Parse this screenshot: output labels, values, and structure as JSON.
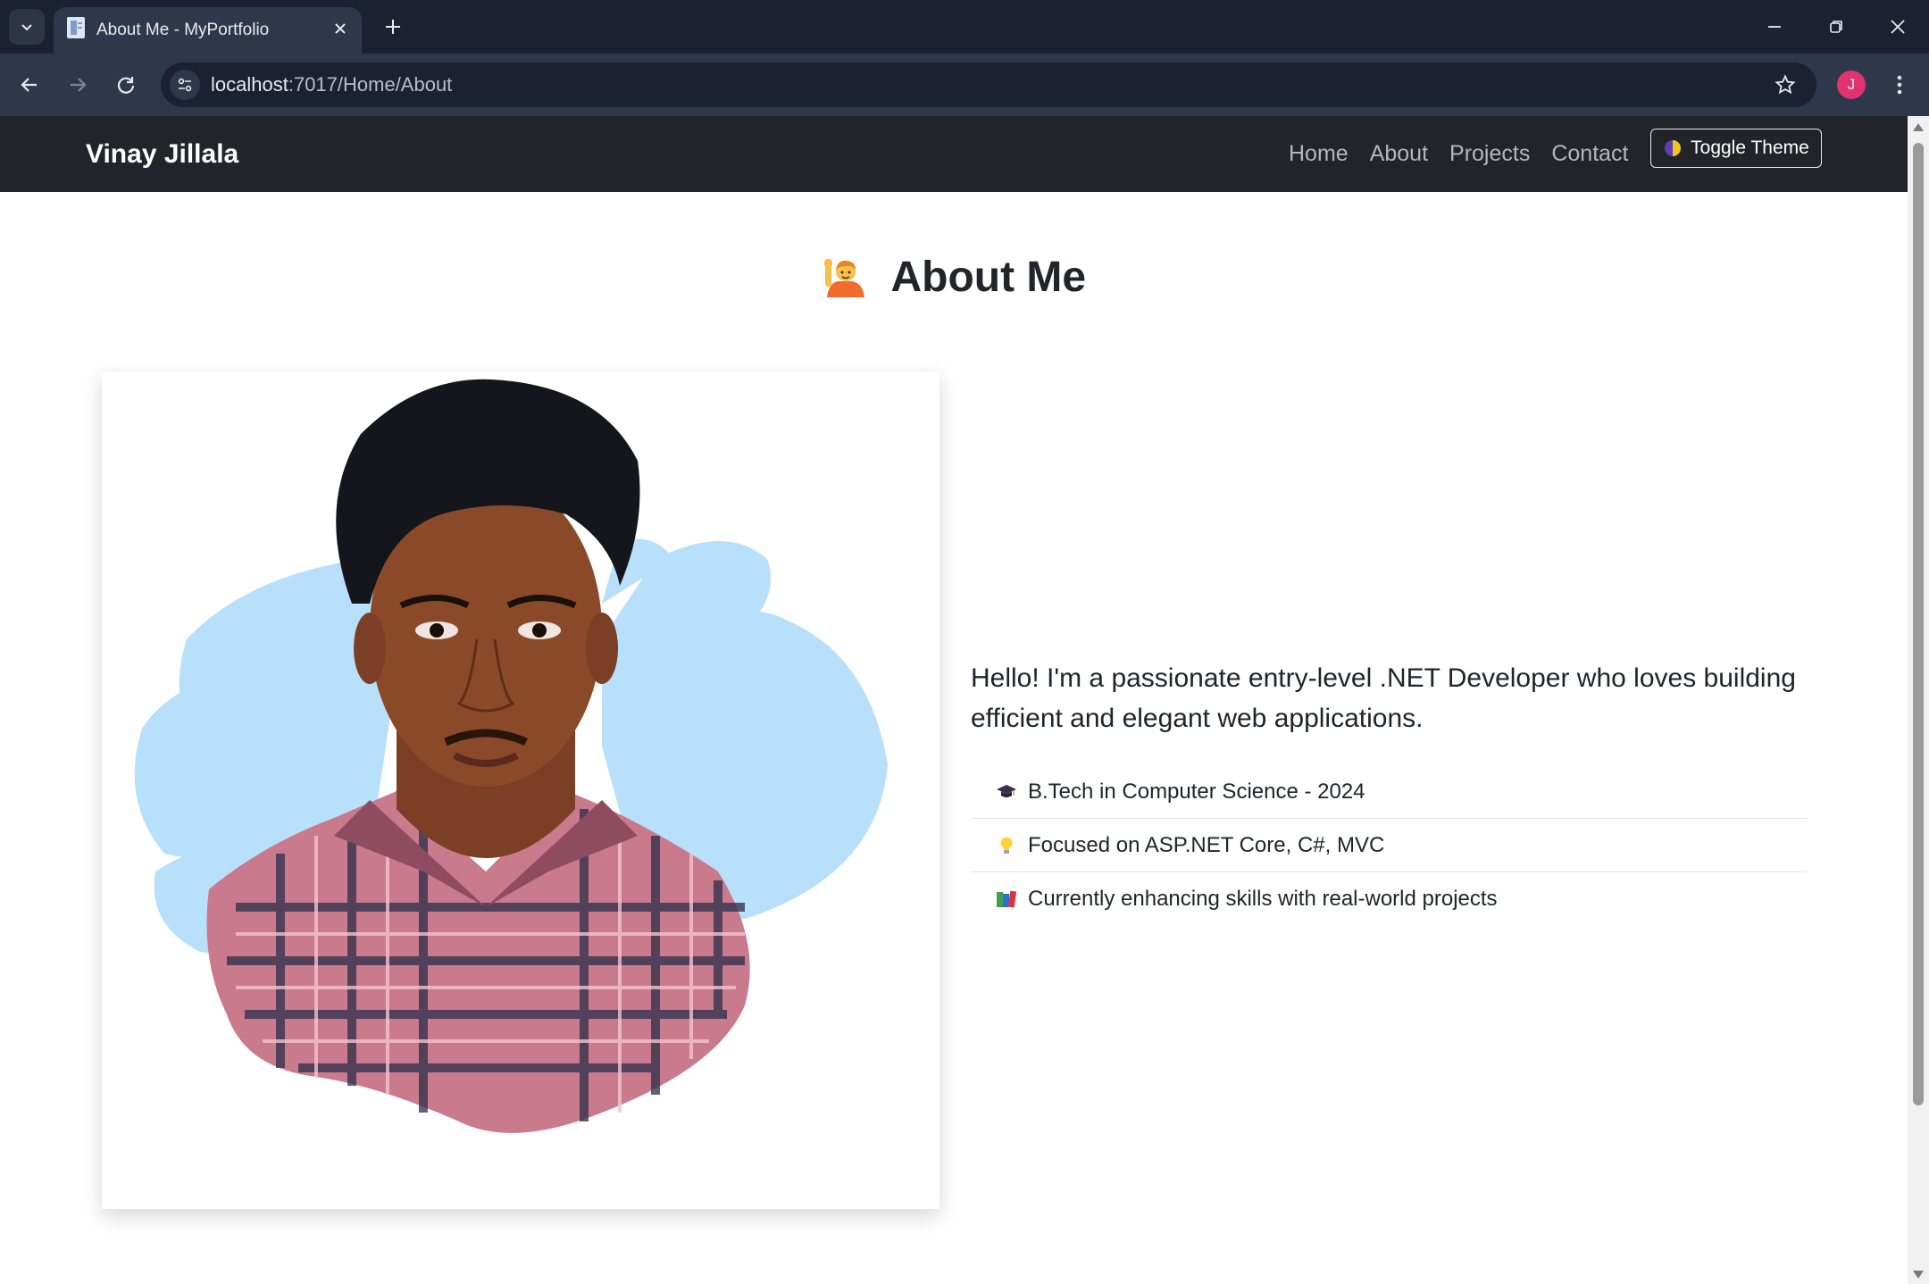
{
  "browser": {
    "tab_title": "About Me - MyPortfolio",
    "url_host": "localhost",
    "url_path": ":7017/Home/About",
    "profile_initial": "J"
  },
  "site": {
    "brand": "Vinay Jillala",
    "nav": [
      "Home",
      "About",
      "Projects",
      "Contact"
    ],
    "toggle_label": "Toggle Theme"
  },
  "about": {
    "heading": "About Me",
    "intro": "Hello! I'm a passionate entry-level .NET Developer who loves building efficient and elegant web applications.",
    "facts": [
      {
        "icon": "graduation-cap-icon",
        "text": "B.Tech in Computer Science - 2024"
      },
      {
        "icon": "lightbulb-icon",
        "text": "Focused on ASP.NET Core, C#, MVC"
      },
      {
        "icon": "books-icon",
        "text": "Currently enhancing skills with real-world projects"
      }
    ]
  },
  "colors": {
    "navbar_bg": "#212529",
    "brush_stroke": "#b9e0fb",
    "chrome_bg": "#1b2132",
    "profile_avatar": "#e0336f"
  }
}
